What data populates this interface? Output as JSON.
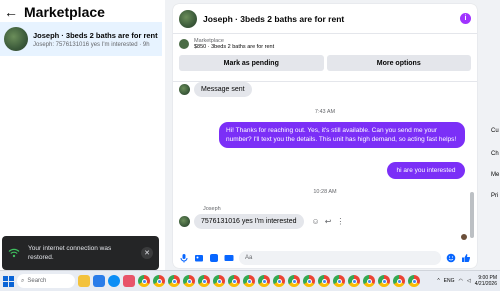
{
  "marketplace": {
    "title": "Marketplace",
    "conversation": {
      "name": "Joseph · 3beds 2 baths are for rent",
      "preview": "Joseph: 7576131016 yes I'm interested · 9h"
    }
  },
  "toast": {
    "text": "Your internet connection was restored."
  },
  "chat": {
    "header_name": "Joseph · 3beds 2 baths are for rent",
    "listing_label": "Marketplace",
    "listing_title": "$850 · 3beds 2 baths are for rent",
    "mark_pending_label": "Mark as pending",
    "more_options_label": "More options",
    "messages": {
      "first_in": "Message sent",
      "time_1": "7:43 AM",
      "out_long": "Hi! Thanks for reaching out. Yes, it's still available. Can you send me your number? I'll text you the details. This unit has high demand, so acting fast helps!",
      "out_short": "hi are you interested",
      "time_2": "10:28 AM",
      "sender": "Joseph",
      "last_in": "7576131016 yes I'm interested"
    },
    "composer_placeholder": "Aa"
  },
  "right_panel": {
    "labels": [
      "Cu",
      "Ch",
      "Me",
      "Pri"
    ]
  },
  "taskbar": {
    "search_placeholder": "Search",
    "language": "ENG",
    "time": "9:00 PM",
    "date": "4/21/2026"
  },
  "colors": {
    "accent": "#7b2ff7",
    "selected": "#e7f3ff"
  }
}
